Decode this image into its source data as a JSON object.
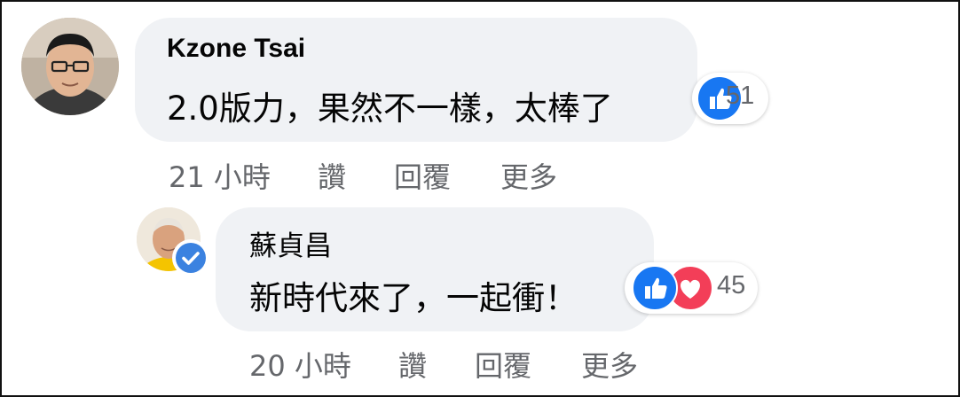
{
  "comments": [
    {
      "author": "Kzone Tsai",
      "text": "2.0版力，果然不一樣，太棒了",
      "reaction_count": "51",
      "time": "21 小時",
      "like_label": "讚",
      "reply_label": "回覆",
      "more_label": "更多"
    },
    {
      "author": "蘇貞昌",
      "text": "新時代來了，一起衝！",
      "reaction_count": "45",
      "time": "20 小時",
      "like_label": "讚",
      "reply_label": "回覆",
      "more_label": "更多"
    }
  ],
  "colors": {
    "like_blue": "#1877f2",
    "love_red": "#f33e58",
    "bubble_bg": "#f0f2f5",
    "meta_gray": "#65676b",
    "verified_blue": "#3b82e0"
  }
}
